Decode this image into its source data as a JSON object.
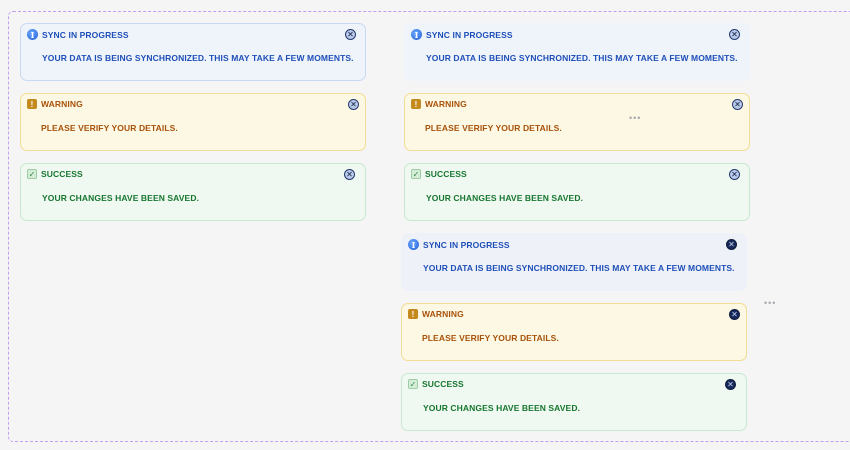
{
  "alerts": {
    "info": {
      "title": "SYNC IN PROGRESS",
      "message": "YOUR DATA IS BEING SYNCHRONIZED. THIS MAY TAKE A FEW MOMENTS."
    },
    "warning": {
      "title": "WARNING",
      "message": "PLEASE VERIFY YOUR DETAILS."
    },
    "success": {
      "title": "SUCCESS",
      "message": "YOUR CHANGES HAVE BEEN SAVED."
    }
  },
  "icons": {
    "info": "info-icon",
    "warning": "warning-icon",
    "success": "check-icon",
    "close": "close-icon",
    "more": "more-dots-icon"
  },
  "glyphs": {
    "info": "i",
    "warning": "!",
    "success": "✓",
    "close": "✕",
    "more": "•••"
  },
  "colors": {
    "info_text": "#1f4fb8",
    "warning_text": "#a8520a",
    "success_text": "#17772f",
    "frame_border": "#c39ef0"
  }
}
